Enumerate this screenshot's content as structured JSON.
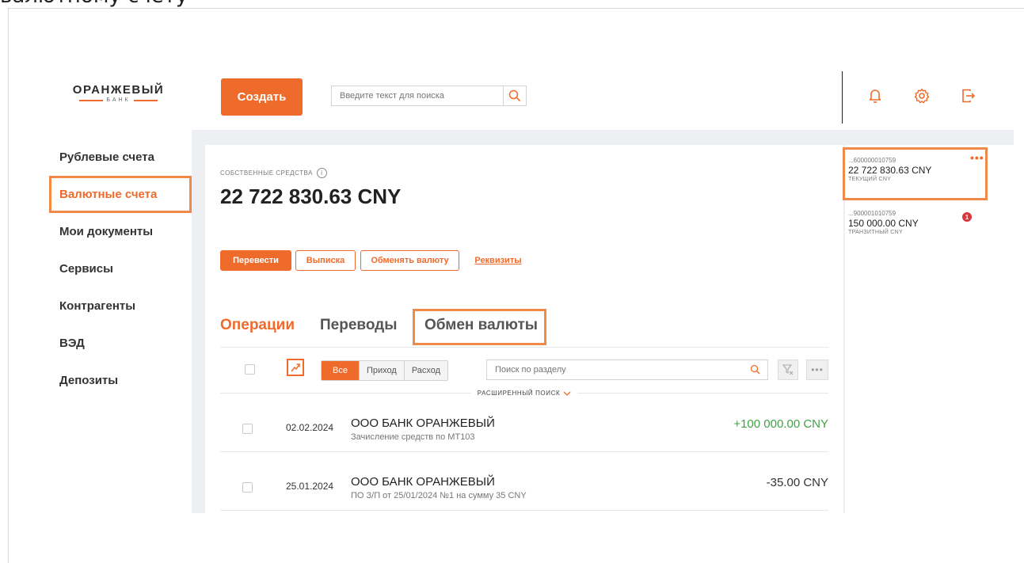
{
  "caption": "валютному счету",
  "logo": {
    "main": "ОРАНЖЕВЫЙ",
    "sub": "БАНК"
  },
  "header": {
    "create_label": "Создать",
    "search_placeholder": "Введите текст для поиска",
    "icons": [
      "search-icon",
      "bell-icon",
      "gear-icon",
      "logout-icon"
    ]
  },
  "sidebar": {
    "items": [
      {
        "label": "Рублевые счета"
      },
      {
        "label": "Валютные счета"
      },
      {
        "label": "Мои документы"
      },
      {
        "label": "Сервисы"
      },
      {
        "label": "Контрагенты"
      },
      {
        "label": "ВЭД"
      },
      {
        "label": "Депозиты"
      }
    ],
    "active_index": 1
  },
  "account": {
    "funds_label": "СОБСТВЕННЫЕ СРЕДСТВА",
    "funds_value": "22 722 830.63 CNY"
  },
  "actions": {
    "transfer": "Перевести",
    "statement": "Выписка",
    "exchange": "Обменять валюту",
    "requisites": "Реквизиты"
  },
  "tabs": [
    {
      "label": "Операции",
      "active": true
    },
    {
      "label": "Переводы",
      "active": false
    },
    {
      "label": "Обмен валюты",
      "active": false
    }
  ],
  "filters": {
    "all": "Все",
    "income": "Приход",
    "expense": "Расход",
    "search_placeholder": "Поиск по разделу",
    "advanced_search": "РАСШИРЕННЫЙ ПОИСК"
  },
  "operations": [
    {
      "date": "02.02.2024",
      "counterparty": "ООО БАНК ОРАНЖЕВЫЙ",
      "description": "Зачисление средств по МТ103",
      "amount": "+100 000.00 CNY",
      "color": "#43a047"
    },
    {
      "date": "25.01.2024",
      "counterparty": "ООО БАНК ОРАНЖЕВЫЙ",
      "description": "ПО З/П от 25/01/2024 №1 на сумму 35 CNY",
      "amount": "-35.00 CNY",
      "color": "#333333"
    }
  ],
  "accounts": [
    {
      "number": "...600000010759",
      "balance": "22 722 830.63 CNY",
      "type": "ТЕКУЩИЙ CNY"
    },
    {
      "number": "...900001010759",
      "balance": "150 000.00 CNY",
      "type": "ТРАНЗИТНЫЙ CNY",
      "badge": "1"
    }
  ],
  "colors": {
    "accent": "#ef6b2c",
    "highlight": "#f08a4b",
    "positive": "#43a047",
    "badge": "#d9363e"
  }
}
